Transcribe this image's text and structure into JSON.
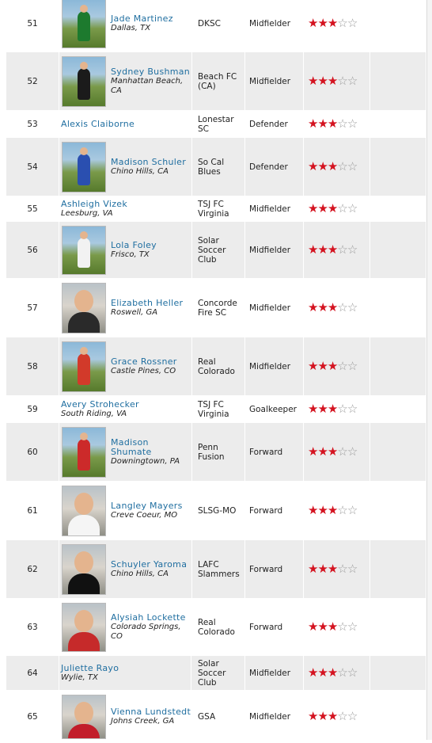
{
  "rows": [
    {
      "rank": "51",
      "name": "Jade Martinez",
      "city": "Dallas, TX",
      "club": "DKSC",
      "position": "Midfielder",
      "stars": 3,
      "photo": true,
      "jersey": "#1d7a2e",
      "scene": "field"
    },
    {
      "rank": "52",
      "name": "Sydney Bushman",
      "city": "Manhattan Beach, CA",
      "club": "Beach FC (CA)",
      "position": "Midfielder",
      "stars": 3,
      "photo": true,
      "jersey": "#1b1b1b",
      "scene": "field"
    },
    {
      "rank": "53",
      "name": "Alexis Claiborne",
      "city": "",
      "club": "Lonestar SC",
      "position": "Defender",
      "stars": 3,
      "photo": false
    },
    {
      "rank": "54",
      "name": "Madison Schuler",
      "city": "Chino Hills, CA",
      "club": "So Cal Blues",
      "position": "Defender",
      "stars": 3,
      "photo": true,
      "jersey": "#2a4fb0",
      "scene": "field"
    },
    {
      "rank": "55",
      "name": "Ashleigh Vizek",
      "city": "Leesburg, VA",
      "club": "TSJ FC Virginia",
      "position": "Midfielder",
      "stars": 3,
      "photo": false
    },
    {
      "rank": "56",
      "name": "Lola Foley",
      "city": "Frisco, TX",
      "club": "Solar Soccer Club",
      "position": "Midfielder",
      "stars": 3,
      "photo": true,
      "jersey": "#f2f2f2",
      "scene": "field"
    },
    {
      "rank": "57",
      "name": "Elizabeth Heller",
      "city": "Roswell, GA",
      "club": "Concorde Fire SC",
      "position": "Midfielder",
      "stars": 3,
      "photo": true,
      "jersey": "#2a2a2a",
      "scene": "portrait"
    },
    {
      "rank": "58",
      "name": "Grace Rossner",
      "city": "Castle Pines, CO",
      "club": "Real Colorado",
      "position": "Midfielder",
      "stars": 3,
      "photo": true,
      "jersey": "#d23a2a",
      "scene": "field"
    },
    {
      "rank": "59",
      "name": "Avery Strohecker",
      "city": "South Riding, VA",
      "club": "TSJ FC Virginia",
      "position": "Goalkeeper",
      "stars": 3,
      "photo": false
    },
    {
      "rank": "60",
      "name": "Madison Shumate",
      "city": "Downingtown, PA",
      "club": "Penn Fusion",
      "position": "Forward",
      "stars": 3,
      "photo": true,
      "jersey": "#cc2a2a",
      "scene": "field"
    },
    {
      "rank": "61",
      "name": "Langley Mayers",
      "city": "Creve Coeur, MO",
      "club": "SLSG-MO",
      "position": "Forward",
      "stars": 3,
      "photo": true,
      "jersey": "#f5f5f5",
      "scene": "portrait"
    },
    {
      "rank": "62",
      "name": "Schuyler Yaroma",
      "city": "Chino Hills, CA",
      "club": "LAFC Slammers",
      "position": "Forward",
      "stars": 3,
      "photo": true,
      "jersey": "#111111",
      "scene": "portrait"
    },
    {
      "rank": "63",
      "name": "Alysiah Lockette",
      "city": "Colorado Springs, CO",
      "club": "Real Colorado",
      "position": "Forward",
      "stars": 3,
      "photo": true,
      "jersey": "#c62a2a",
      "scene": "portrait"
    },
    {
      "rank": "64",
      "name": "Juliette Rayo",
      "city": "Wylie, TX",
      "club": "Solar Soccer Club",
      "position": "Midfielder",
      "stars": 3,
      "photo": false
    },
    {
      "rank": "65",
      "name": "Vienna Lundstedt",
      "city": "Johns Creek, GA",
      "club": "GSA",
      "position": "Midfielder",
      "stars": 3,
      "photo": true,
      "jersey": "#c21d2a",
      "scene": "portrait"
    }
  ],
  "star_colors": {
    "full": "#d41320",
    "empty": "#9a9a9a"
  },
  "name_color": "#1f6ea0"
}
